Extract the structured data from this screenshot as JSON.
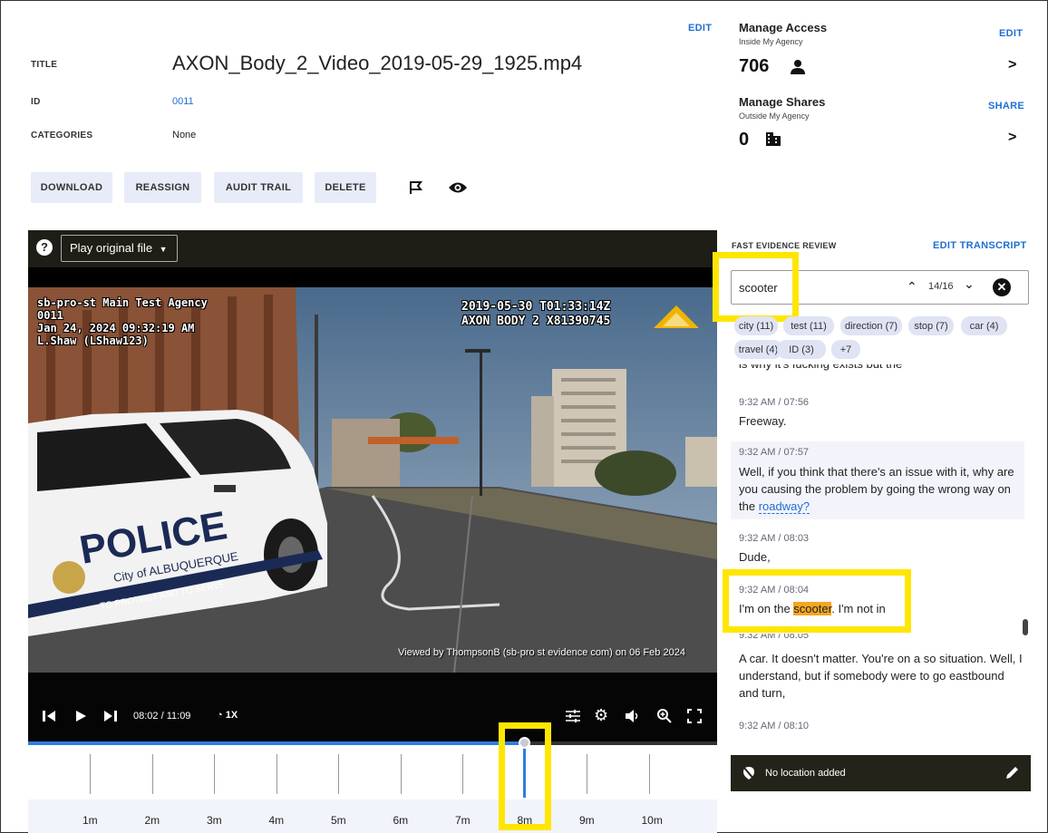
{
  "header": {
    "title_label": "TITLE",
    "title_value": "AXON_Body_2_Video_2019-05-29_1925.mp4",
    "id_label": "ID",
    "id_value": "0011",
    "categories_label": "CATEGORIES",
    "categories_value": "None",
    "edit_label": "EDIT"
  },
  "actions": {
    "download": "DOWNLOAD",
    "reassign": "REASSIGN",
    "audit_trail": "AUDIT TRAIL",
    "delete": "DELETE",
    "flag_icon": "flag-icon",
    "view_icon": "eye-icon"
  },
  "access": {
    "manage_access": "Manage Access",
    "inside": "Inside My Agency",
    "access_count": "706",
    "edit": "EDIT",
    "manage_shares": "Manage Shares",
    "outside": "Outside My Agency",
    "share_count": "0",
    "share": "SHARE",
    "chevron": ">"
  },
  "player": {
    "help_icon": "?",
    "play_original": "Play original file",
    "overlay_left": [
      "sb-pro-st Main Test Agency",
      "0011",
      "Jan 24, 2024 09:32:19 AM",
      "L.Shaw (LShaw123)"
    ],
    "overlay_right": [
      "2019-05-30 T01:33:14Z",
      "AXON BODY 2 X81390745"
    ],
    "watermark": "Viewed by ThompsonB (sb-pro st evidence com) on 06 Feb 2024",
    "current_time": "08:02",
    "time_sep": "/",
    "duration": "11:09",
    "speed": "1X",
    "progress": 0.72
  },
  "timeline": {
    "labels": [
      "1m",
      "2m",
      "3m",
      "4m",
      "5m",
      "6m",
      "7m",
      "8m",
      "9m",
      "10m"
    ]
  },
  "review": {
    "heading": "FAST EVIDENCE REVIEW",
    "edit_transcript": "EDIT TRANSCRIPT",
    "search_value": "scooter",
    "match_counter": "14/16",
    "chips": [
      "city (11)",
      "test (11)",
      "direction (7)",
      "stop (7)",
      "car (4)",
      "travel (4)",
      "ID (3)",
      "+7"
    ],
    "partial_line": "is why it's fucking exists but the",
    "entries": [
      {
        "ts": "9:32 AM / 07:56",
        "text": "Freeway."
      },
      {
        "ts": "9:32 AM / 07:57",
        "text": "Well, if you think that there's an issue with it, why are you causing the problem by going the wrong way on the",
        "link": "roadway?"
      },
      {
        "ts": "9:32 AM / 08:03",
        "text": "Dude,"
      },
      {
        "ts": "9:32 AM / 08:04",
        "pre": "I'm on the ",
        "match": "scooter",
        "post": ". I'm not in"
      },
      {
        "ts": "9:32 AM / 08:05",
        "text": "A car. It doesn't matter. You're on a so situation. Well, I understand, but if somebody were to go eastbound and turn,"
      },
      {
        "ts": "9:32 AM / 08:10",
        "text": ""
      }
    ],
    "location": "No location added"
  },
  "colors": {
    "accent": "#1f6fd1",
    "highlight_box": "#ffe600",
    "match_bg": "#f5a623",
    "progress": "#2f7de1"
  }
}
